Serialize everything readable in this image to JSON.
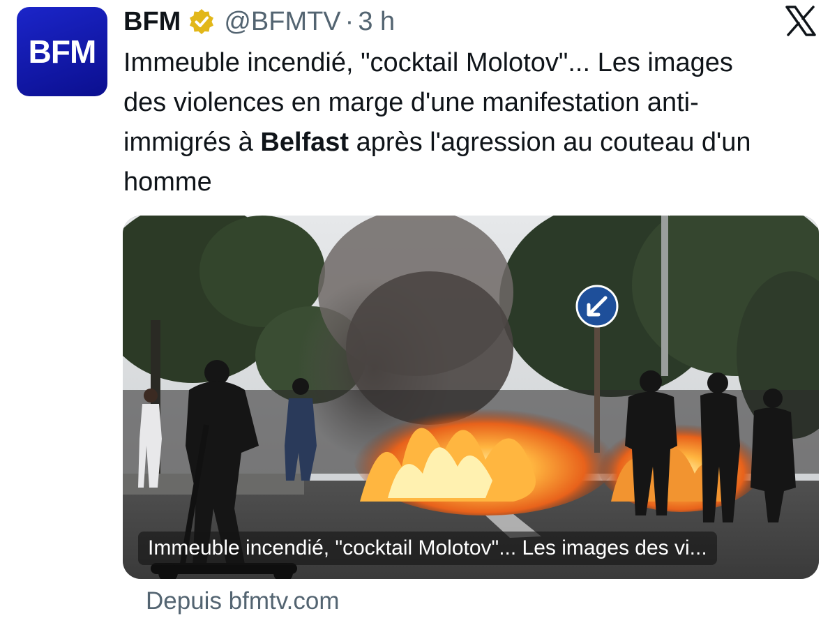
{
  "account": {
    "avatar_text": "BFM",
    "display_name": "BFM",
    "handle": "@BFMTV",
    "separator": "·",
    "time": "3 h"
  },
  "tweet": {
    "text_part1": "Immeuble incendié, \"cocktail Molotov\"... Les images des violences en marge d'une manifestation anti-immigrés à ",
    "text_bold": "Belfast",
    "text_part2": " après l'agression au couteau d'un homme"
  },
  "link_card": {
    "caption": "Immeuble incendié, \"cocktail Molotov\"... Les images des vi...",
    "source": "Depuis bfmtv.com"
  },
  "icons": {
    "verified": "verified-badge-icon",
    "close": "x-logo-icon",
    "sign": "keep-left-arrow-sign"
  },
  "colors": {
    "avatar_bg": "#1b25c9",
    "verified_gold": "#e2b719",
    "secondary_text": "#536471"
  }
}
